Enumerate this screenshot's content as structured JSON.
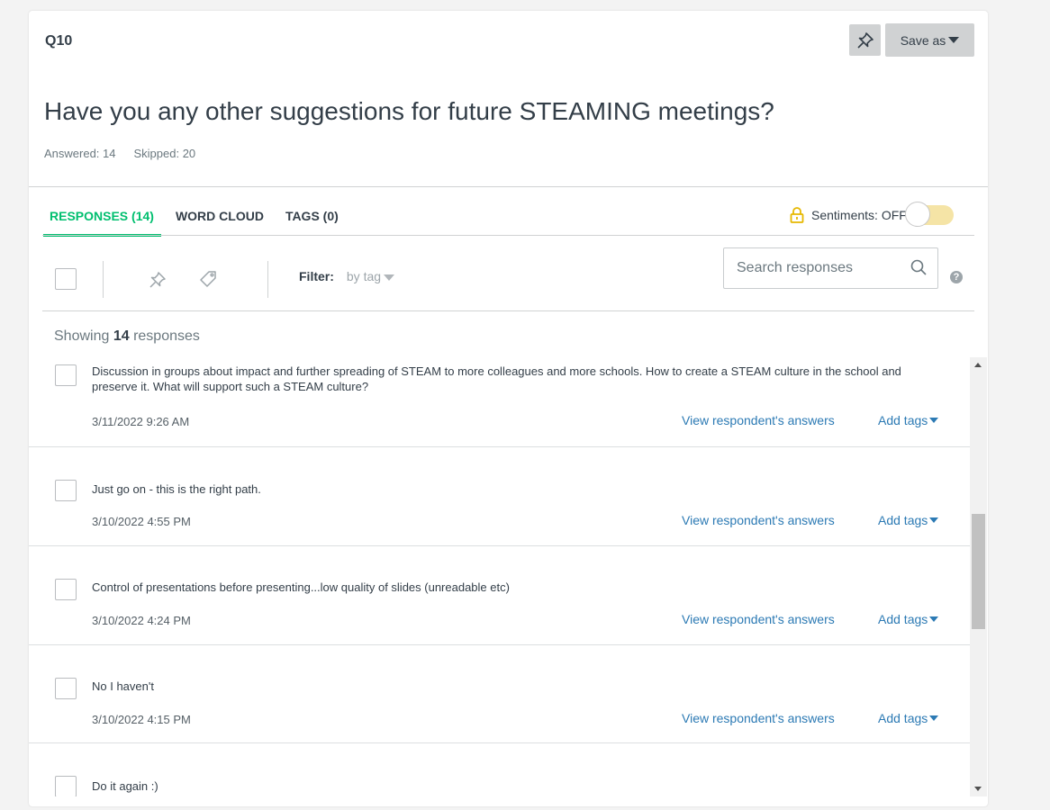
{
  "question": {
    "number": "Q10",
    "title": "Have you any other suggestions for future STEAMING meetings?",
    "answered_label": "Answered: 14",
    "skipped_label": "Skipped: 20"
  },
  "header_actions": {
    "save_as_label": "Save as"
  },
  "tabs": [
    {
      "label": "RESPONSES (14)",
      "active": true
    },
    {
      "label": "WORD CLOUD",
      "active": false
    },
    {
      "label": "TAGS (0)",
      "active": false
    }
  ],
  "sentiments": {
    "label": "Sentiments: OFF",
    "enabled": false
  },
  "toolbar": {
    "filter_label": "Filter:",
    "filter_value": "by tag",
    "search_placeholder": "Search responses",
    "help_glyph": "?"
  },
  "summary": {
    "showing_prefix": "Showing",
    "count": "14",
    "showing_suffix": "responses"
  },
  "responses": [
    {
      "text": "Discussion in groups about impact and further spreading of STEAM to more colleagues and more schools. How to create a STEAM culture in the school and preserve it. What will support such a STEAM culture?",
      "date": "3/11/2022 9:26 AM",
      "view_label": "View respondent's answers",
      "tags_label": "Add tags"
    },
    {
      "text": "Just go on - this is the right path.",
      "date": "3/10/2022 4:55 PM",
      "view_label": "View respondent's answers",
      "tags_label": "Add tags"
    },
    {
      "text": "Control of presentations before presenting...low quality of slides (unreadable etc)",
      "date": "3/10/2022 4:24 PM",
      "view_label": "View respondent's answers",
      "tags_label": "Add tags"
    },
    {
      "text": "No I haven't",
      "date": "3/10/2022 4:15 PM",
      "view_label": "View respondent's answers",
      "tags_label": "Add tags"
    },
    {
      "text": "Do it again :)",
      "date": "",
      "view_label": "",
      "tags_label": ""
    }
  ],
  "colors": {
    "accent_green": "#00bf6f",
    "link_blue": "#2c7ab4",
    "toggle_track": "#f5e4a6",
    "lock_yellow": "#e6b800"
  }
}
